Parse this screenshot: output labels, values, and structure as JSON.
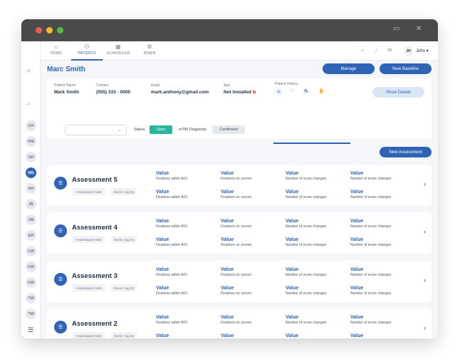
{
  "nav": {
    "items": [
      {
        "label": "HOME",
        "icon": "home-icon",
        "glyph": "⌂"
      },
      {
        "label": "PATIENTS",
        "icon": "patients-icon",
        "glyph": "⚇"
      },
      {
        "label": "SCHEDULER",
        "icon": "calendar-icon",
        "glyph": "▦"
      },
      {
        "label": "ADMIN",
        "icon": "admin-icon",
        "glyph": "⚙"
      }
    ],
    "active_index": 1,
    "user_initials": "JH",
    "user_name": "John ▾"
  },
  "sidebar": {
    "avatars": [
      "CH",
      "KM",
      "GH",
      "MS",
      "AH",
      "JB",
      "JW",
      "EH",
      "CW",
      "CW",
      "CW",
      "TW",
      "TW"
    ],
    "active_index": 3
  },
  "patient": {
    "name": "Marc Smith",
    "manage_label": "Manage",
    "new_baseline_label": "New Baseline",
    "fields": {
      "name_label": "Patient Name",
      "name_value": "Mark Smith",
      "contact_label": "Contact",
      "contact_value": "(555) 333 - 0000",
      "email_label": "Email",
      "email_value": "mark.anthony@gmail.com",
      "app_label": "App",
      "app_value": "Not Installed",
      "history_label": "Patient History"
    },
    "show_details_label": "Show Details",
    "status_label": "Status",
    "status_value": "Open",
    "diagnosis_label": "mTBI Diagnosis",
    "diagnosis_value": "Confirmed"
  },
  "new_assessment_label": "New Assessment",
  "assessments": [
    {
      "title": "Assessment 5",
      "visit": "Subsequent Visit",
      "event": "Event: Aug 03"
    },
    {
      "title": "Assessment 4",
      "visit": "Subsequent Visit",
      "event": "Event: Aug 03"
    },
    {
      "title": "Assessment 3",
      "visit": "Subsequent Visit",
      "event": "Event: Aug 03"
    },
    {
      "title": "Assessment 2",
      "visit": "Subsequent Visit",
      "event": "Event: Aug 03"
    }
  ],
  "metrics": [
    {
      "value": "Value",
      "label": "Fixations within AOI"
    },
    {
      "value": "Value",
      "label": "Fixations on screen"
    },
    {
      "value": "Value",
      "label": "Number of score changes"
    },
    {
      "value": "Value",
      "label": "Number of score changes"
    },
    {
      "value": "Value",
      "label": "Fixations within AOI"
    },
    {
      "value": "Value",
      "label": "Fixations on screen"
    },
    {
      "value": "Value",
      "label": "Number of score changes"
    },
    {
      "value": "Value",
      "label": "Number of score changes"
    }
  ],
  "colors": {
    "accent": "#2f64b4",
    "open": "#2bb5a0",
    "external": "#e04b3c"
  }
}
